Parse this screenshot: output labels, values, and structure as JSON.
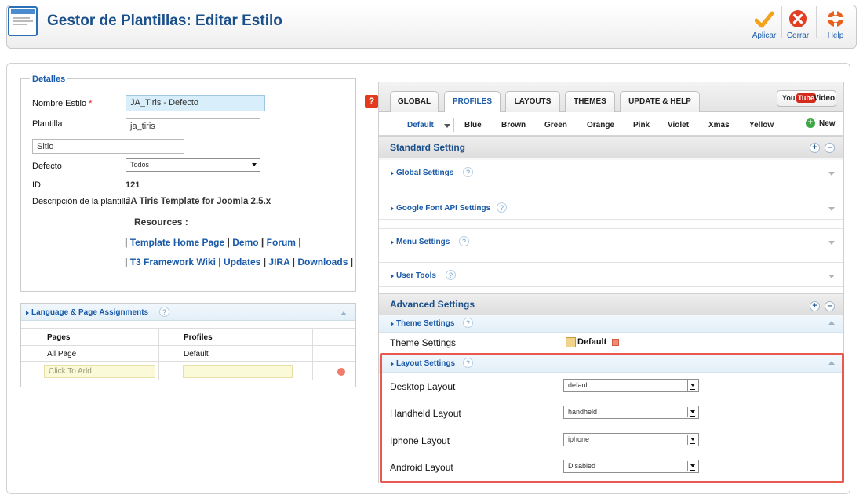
{
  "header": {
    "title": "Gestor de Plantillas: Editar Estilo",
    "buttons": {
      "apply": "Aplicar",
      "close": "Cerrar",
      "help": "Help"
    },
    "colors": {
      "apply_icon": "#f1a31a",
      "close_icon": "#e13f23",
      "help_icon": "#e8601c"
    }
  },
  "details": {
    "legend": "Detalles",
    "style_name_label": "Nombre Estilo",
    "required_mark": "*",
    "style_name_value": "JA_Tiris - Defecto",
    "template_label": "Plantilla",
    "template_value": "ja_tiris",
    "site_value": "Sitio",
    "default_label": "Defecto",
    "default_value": "Todos",
    "id_label": "ID",
    "id_value": "121",
    "description_label": "Descripción de la plantilla",
    "description_value": "JA Tiris Template for Joomla 2.5.x",
    "resources_label": "Resources :",
    "links_row1": [
      "Template Home Page",
      "Demo",
      "Forum"
    ],
    "links_row2": [
      "T3 Framework Wiki",
      "Updates",
      "JIRA",
      "Downloads"
    ],
    "separator": "|"
  },
  "assignments": {
    "title": "Language & Page Assignments",
    "help": "?",
    "headers": [
      "Pages",
      "Profiles"
    ],
    "rows": [
      [
        "All Page",
        "Default"
      ]
    ],
    "add_placeholder": "Click To Add"
  },
  "right": {
    "help_badge": "?",
    "tabs": [
      "GLOBAL",
      "PROFILES",
      "LAYOUTS",
      "THEMES",
      "UPDATE & HELP"
    ],
    "active_tab": "PROFILES",
    "youtube": {
      "you": "You",
      "tube": "Tube",
      "label": "Video"
    },
    "profiles": [
      "Default",
      "Blue",
      "Brown",
      "Green",
      "Orange",
      "Pink",
      "Violet",
      "Xmas",
      "Yellow"
    ],
    "active_profile": "Default",
    "new_label": "New",
    "standard_title": "Standard Setting",
    "standard_items": [
      "Global Settings",
      "Google Font API Settings",
      "Menu Settings",
      "User Tools"
    ],
    "advanced_title": "Advanced Settings",
    "theme_settings_title": "Theme Settings",
    "theme_settings_label": "Theme Settings",
    "theme_settings_value": "Default",
    "layout_settings_title": "Layout Settings",
    "layouts": [
      {
        "label": "Desktop Layout",
        "value": "default"
      },
      {
        "label": "Handheld Layout",
        "value": "handheld"
      },
      {
        "label": "Iphone Layout",
        "value": "iphone"
      },
      {
        "label": "Android Layout",
        "value": "Disabled"
      }
    ],
    "help_mark": "?",
    "plus": "+",
    "minus": "–"
  },
  "colors": {
    "link": "#1a5aa8",
    "title": "#1a4f8b",
    "highlight": "#e85a4f"
  }
}
